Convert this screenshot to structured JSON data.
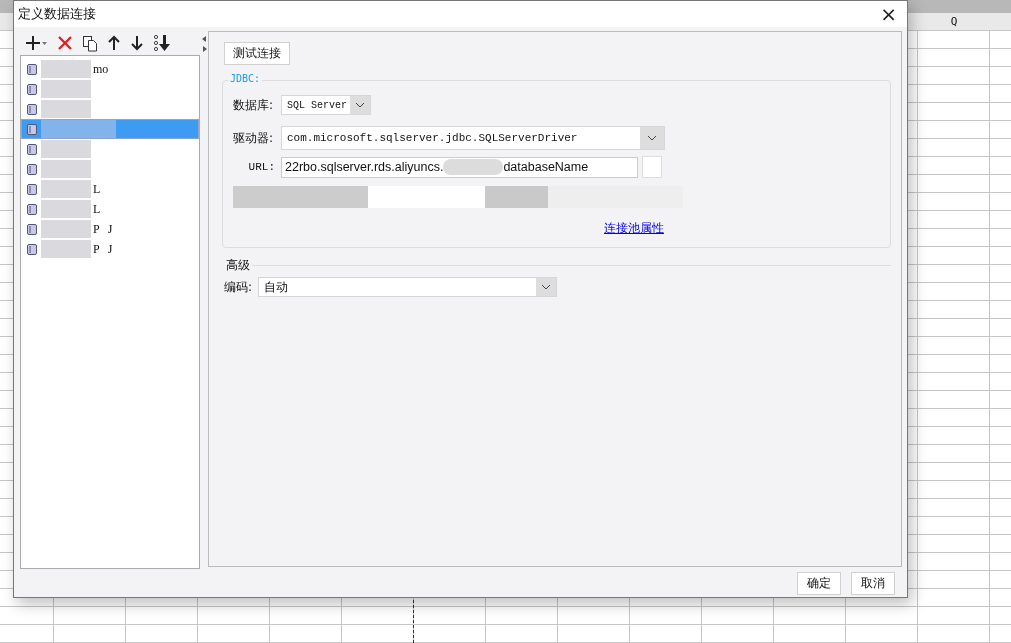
{
  "sheet": {
    "column_header": "Q"
  },
  "window": {
    "title": "定义数据连接",
    "close": "×"
  },
  "toolbar": [
    {
      "kind": "add"
    },
    {
      "kind": "delete"
    },
    {
      "kind": "copy"
    },
    {
      "kind": "up"
    },
    {
      "kind": "down"
    },
    {
      "kind": "bottom"
    }
  ],
  "connections": [
    {
      "fragments": [
        "mo"
      ],
      "selected": false
    },
    {
      "selected": false
    },
    {
      "selected": false
    },
    {
      "selected": true
    },
    {
      "selected": false
    },
    {
      "selected": false
    },
    {
      "fragments": [
        "L"
      ],
      "selected": false
    },
    {
      "fragments": [
        "L"
      ],
      "selected": false
    },
    {
      "fragments": [
        "P",
        "J"
      ],
      "selected": false
    },
    {
      "fragments": [
        "P",
        "J"
      ],
      "selected": false
    }
  ],
  "test_button": "测试连接",
  "jdbc": {
    "legend": "JDBC:",
    "database": {
      "label": "数据库:",
      "value": "SQL Server"
    },
    "driver": {
      "label": "驱动器:",
      "value": "com.microsoft.sqlserver.jdbc.SQLServerDriver"
    },
    "url": {
      "label": "URL:",
      "value_start": "22rbo.sqlserver.rds.aliyuncs.",
      "value_end": "databaseName"
    },
    "pool_link": "连接池属性"
  },
  "advanced": {
    "legend": "高级",
    "encoding": {
      "label": "编码:",
      "value": "自动"
    }
  },
  "buttons": [
    "确定",
    "取消"
  ]
}
